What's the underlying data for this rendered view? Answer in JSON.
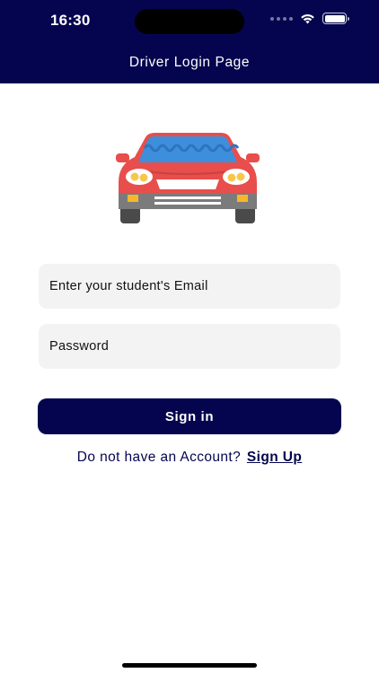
{
  "status_bar": {
    "time": "16:30"
  },
  "header": {
    "title": "Driver Login Page",
    "background_color": "#05054f"
  },
  "illustration": {
    "icon": "car-icon",
    "body_color": "#e84e4b",
    "windshield_color": "#3e8fdb"
  },
  "form": {
    "email_placeholder": "Enter your student's Email",
    "password_placeholder": "Password",
    "signin_label": "Sign in"
  },
  "signup": {
    "prompt": "Do not have an Account?",
    "link_label": "Sign Up"
  },
  "colors": {
    "primary": "#05054f",
    "input_bg": "#f3f3f3"
  }
}
